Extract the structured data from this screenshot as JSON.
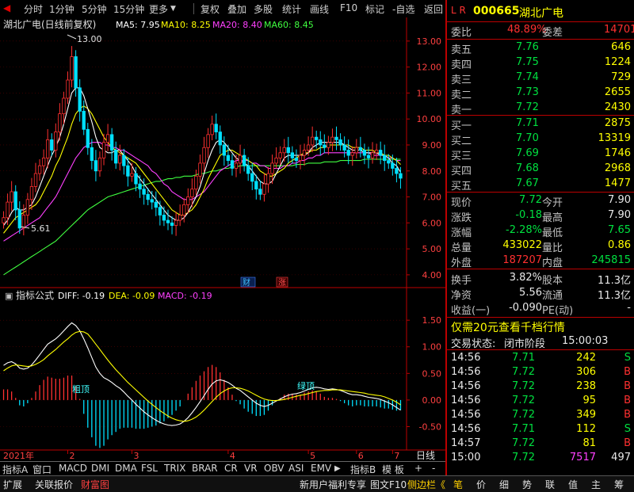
{
  "toolbar": {
    "items": [
      "分时",
      "1分钟",
      "5分钟",
      "15分钟",
      "更多",
      "复权",
      "叠加",
      "多股",
      "统计",
      "画线",
      "F10",
      "标记",
      "-自选",
      "返回"
    ]
  },
  "chart_header": {
    "title": "湖北广电(日线前复权)",
    "ma5": "MA5: 7.95",
    "ma10": "MA10: 8.25",
    "ma20": "MA20: 8.40",
    "ma60": "MA60: 8.45",
    "high_label": "13.00",
    "low_label": "5.61",
    "badge_cai": "财",
    "badge_zhang": "涨"
  },
  "indicator_header": {
    "name": "指标公式",
    "diff": "DIFF: -0.19",
    "dea": "DEA: -0.09",
    "macd": "MACD: -0.19",
    "label_a": "粗顶",
    "label_b": "绿顶"
  },
  "chart_data": [
    {
      "type": "candlestick",
      "ylim": [
        3.6,
        13.3
      ],
      "yticks": [
        "13.00",
        "12.00",
        "11.00",
        "10.00",
        "9.00",
        "8.00",
        "7.00",
        "6.00",
        "5.00",
        "4.00"
      ],
      "series": [
        {
          "name": "MA5",
          "color": "#ffffff"
        },
        {
          "name": "MA10",
          "color": "#ffff00"
        },
        {
          "name": "MA20",
          "color": "#ff40ff"
        },
        {
          "name": "MA60",
          "color": "#40ff40"
        }
      ],
      "close": [
        6.2,
        6.8,
        7.2,
        6.5,
        5.8,
        6.3,
        6.9,
        7.4,
        7.9,
        8.2,
        8.5,
        9.2,
        8.8,
        9.5,
        10.2,
        10.8,
        11.5,
        12.4,
        11.2,
        10.3,
        9.6,
        8.9,
        8.4,
        8.0,
        8.5,
        9.1,
        9.4,
        8.8,
        8.3,
        8.6,
        8.2,
        7.8,
        7.9,
        7.5,
        7.3,
        7.1,
        6.9,
        6.8,
        6.6,
        6.3,
        6.1,
        6.0,
        5.9,
        6.1,
        6.3,
        6.7,
        7.0,
        7.3,
        7.8,
        8.3,
        8.9,
        9.4,
        9.8,
        9.5,
        9.0,
        8.6,
        8.4,
        8.1,
        8.3,
        8.6,
        8.2,
        7.9,
        7.6,
        7.3,
        7.1,
        7.5,
        7.9,
        8.3,
        8.5,
        8.7,
        8.9,
        8.7,
        8.5,
        8.4,
        8.6,
        8.8,
        9.0,
        9.3,
        9.2,
        9.0,
        8.9,
        9.1,
        9.3,
        9.2,
        9.0,
        8.8,
        8.6,
        8.7,
        8.9,
        8.8,
        8.6,
        8.5,
        8.7,
        8.8,
        8.6,
        8.4,
        8.3,
        8.1,
        7.9,
        7.72
      ],
      "ma5": [
        5.9,
        6.1,
        6.4,
        6.6,
        6.5,
        6.5,
        6.6,
        6.7,
        7.0,
        7.4,
        7.8,
        8.2,
        8.6,
        8.9,
        9.3,
        9.8,
        10.4,
        11.0,
        11.2,
        11.2,
        10.9,
        10.4,
        9.9,
        9.3,
        8.9,
        8.8,
        8.7,
        8.7,
        8.8,
        8.8,
        8.6,
        8.4,
        8.2,
        7.9,
        7.7,
        7.5,
        7.3,
        7.1,
        6.9,
        6.7,
        6.5,
        6.3,
        6.2,
        6.1,
        6.1,
        6.2,
        6.4,
        6.7,
        7.0,
        7.4,
        7.9,
        8.4,
        8.8,
        9.1,
        9.2,
        9.1,
        8.9,
        8.7,
        8.5,
        8.4,
        8.3,
        8.2,
        8.0,
        7.8,
        7.6,
        7.5,
        7.5,
        7.6,
        7.9,
        8.2,
        8.5,
        8.6,
        8.6,
        8.6,
        8.6,
        8.6,
        8.7,
        8.9,
        9.0,
        9.1,
        9.1,
        9.1,
        9.1,
        9.1,
        9.1,
        9.0,
        8.9,
        8.8,
        8.8,
        8.8,
        8.7,
        8.7,
        8.7,
        8.7,
        8.6,
        8.6,
        8.5,
        8.3,
        8.2,
        7.95
      ],
      "ma10": [
        5.6,
        5.8,
        6.0,
        6.2,
        6.3,
        6.4,
        6.5,
        6.6,
        6.7,
        6.9,
        7.2,
        7.5,
        7.8,
        8.2,
        8.5,
        8.9,
        9.3,
        9.8,
        10.2,
        10.4,
        10.5,
        10.4,
        10.2,
        9.9,
        9.6,
        9.3,
        9.1,
        8.9,
        8.8,
        8.7,
        8.6,
        8.5,
        8.4,
        8.3,
        8.1,
        7.9,
        7.7,
        7.5,
        7.3,
        7.1,
        6.9,
        6.7,
        6.5,
        6.4,
        6.3,
        6.3,
        6.4,
        6.5,
        6.7,
        7.0,
        7.3,
        7.7,
        8.0,
        8.3,
        8.6,
        8.7,
        8.8,
        8.8,
        8.7,
        8.6,
        8.5,
        8.4,
        8.3,
        8.2,
        8.0,
        7.9,
        7.8,
        7.8,
        7.9,
        8.0,
        8.1,
        8.3,
        8.4,
        8.5,
        8.6,
        8.7,
        8.7,
        8.8,
        8.8,
        8.9,
        8.9,
        9.0,
        9.0,
        9.0,
        9.0,
        9.0,
        9.0,
        8.9,
        8.9,
        8.9,
        8.8,
        8.8,
        8.8,
        8.7,
        8.7,
        8.6,
        8.6,
        8.5,
        8.4,
        8.25
      ],
      "ma20": [
        5.3,
        5.4,
        5.5,
        5.6,
        5.7,
        5.8,
        5.9,
        6.0,
        6.1,
        6.2,
        6.4,
        6.6,
        6.8,
        7.0,
        7.3,
        7.6,
        7.9,
        8.2,
        8.5,
        8.7,
        8.9,
        9.0,
        9.1,
        9.1,
        9.1,
        9.0,
        9.0,
        8.9,
        8.9,
        8.8,
        8.8,
        8.7,
        8.6,
        8.5,
        8.4,
        8.3,
        8.2,
        8.0,
        7.9,
        7.7,
        7.5,
        7.4,
        7.2,
        7.1,
        7.0,
        6.9,
        6.9,
        6.9,
        7.0,
        7.1,
        7.2,
        7.4,
        7.6,
        7.8,
        8.0,
        8.1,
        8.2,
        8.3,
        8.4,
        8.4,
        8.4,
        8.4,
        8.3,
        8.3,
        8.2,
        8.2,
        8.1,
        8.1,
        8.1,
        8.1,
        8.2,
        8.2,
        8.3,
        8.3,
        8.4,
        8.4,
        8.5,
        8.5,
        8.6,
        8.6,
        8.7,
        8.7,
        8.7,
        8.7,
        8.7,
        8.7,
        8.7,
        8.7,
        8.7,
        8.7,
        8.7,
        8.7,
        8.6,
        8.6,
        8.6,
        8.6,
        8.5,
        8.5,
        8.4,
        8.4
      ],
      "ma60": [
        4.0,
        4.1,
        4.2,
        4.3,
        4.4,
        4.5,
        4.6,
        4.7,
        4.8,
        4.9,
        5.0,
        5.1,
        5.2,
        5.3,
        5.45,
        5.6,
        5.75,
        5.9,
        6.05,
        6.2,
        6.35,
        6.5,
        6.6,
        6.7,
        6.8,
        6.9,
        7.0,
        7.05,
        7.1,
        7.15,
        7.2,
        7.25,
        7.3,
        7.35,
        7.4,
        7.45,
        7.5,
        7.55,
        7.6,
        7.6,
        7.65,
        7.7,
        7.7,
        7.75,
        7.75,
        7.8,
        7.8,
        7.8,
        7.85,
        7.9,
        7.9,
        7.95,
        8.0,
        8.0,
        8.05,
        8.1,
        8.1,
        8.15,
        8.15,
        8.2,
        8.2,
        8.2,
        8.2,
        8.2,
        8.2,
        8.2,
        8.2,
        8.2,
        8.2,
        8.2,
        8.2,
        8.2,
        8.2,
        8.25,
        8.25,
        8.25,
        8.3,
        8.3,
        8.3,
        8.3,
        8.35,
        8.35,
        8.35,
        8.35,
        8.4,
        8.4,
        8.4,
        8.4,
        8.4,
        8.4,
        8.45,
        8.45,
        8.45,
        8.45,
        8.45,
        8.45,
        8.45,
        8.45,
        8.45,
        8.45
      ]
    },
    {
      "type": "bar",
      "ylim": [
        -0.85,
        1.8
      ],
      "yticks": [
        "1.50",
        "1.00",
        "0.50",
        "0.00",
        "-0.50"
      ],
      "series": [
        {
          "name": "DIFF",
          "color": "#ffffff"
        },
        {
          "name": "DEA",
          "color": "#ffff00"
        },
        {
          "name": "MACD",
          "color": "#ff40ff"
        }
      ],
      "diff": [
        0.65,
        0.7,
        0.72,
        0.68,
        0.6,
        0.58,
        0.6,
        0.66,
        0.75,
        0.85,
        0.95,
        1.05,
        1.1,
        1.15,
        1.22,
        1.3,
        1.38,
        1.45,
        1.4,
        1.3,
        1.15,
        0.98,
        0.8,
        0.62,
        0.5,
        0.42,
        0.38,
        0.33,
        0.27,
        0.22,
        0.15,
        0.07,
        0.0,
        -0.08,
        -0.15,
        -0.22,
        -0.28,
        -0.33,
        -0.38,
        -0.42,
        -0.45,
        -0.47,
        -0.48,
        -0.47,
        -0.45,
        -0.4,
        -0.33,
        -0.24,
        -0.14,
        -0.03,
        0.08,
        0.2,
        0.3,
        0.36,
        0.38,
        0.36,
        0.33,
        0.28,
        0.22,
        0.18,
        0.12,
        0.06,
        0.0,
        -0.06,
        -0.1,
        -0.12,
        -0.1,
        -0.06,
        -0.02,
        0.02,
        0.06,
        0.09,
        0.11,
        0.12,
        0.14,
        0.17,
        0.2,
        0.23,
        0.24,
        0.23,
        0.21,
        0.2,
        0.21,
        0.2,
        0.18,
        0.15,
        0.12,
        0.1,
        0.1,
        0.09,
        0.07,
        0.05,
        0.04,
        0.03,
        0.01,
        -0.02,
        -0.05,
        -0.09,
        -0.14,
        -0.19
      ],
      "dea": [
        0.55,
        0.6,
        0.64,
        0.66,
        0.65,
        0.64,
        0.63,
        0.64,
        0.67,
        0.71,
        0.76,
        0.83,
        0.89,
        0.95,
        1.02,
        1.09,
        1.15,
        1.22,
        1.27,
        1.29,
        1.28,
        1.24,
        1.15,
        1.05,
        0.95,
        0.85,
        0.75,
        0.66,
        0.57,
        0.49,
        0.41,
        0.33,
        0.26,
        0.19,
        0.12,
        0.05,
        -0.02,
        -0.08,
        -0.14,
        -0.2,
        -0.25,
        -0.3,
        -0.34,
        -0.37,
        -0.39,
        -0.4,
        -0.39,
        -0.36,
        -0.32,
        -0.26,
        -0.19,
        -0.11,
        -0.03,
        0.05,
        0.12,
        0.17,
        0.21,
        0.23,
        0.23,
        0.22,
        0.2,
        0.17,
        0.13,
        0.09,
        0.05,
        0.02,
        0.0,
        -0.01,
        -0.01,
        0.0,
        0.01,
        0.03,
        0.05,
        0.07,
        0.09,
        0.1,
        0.12,
        0.14,
        0.16,
        0.17,
        0.18,
        0.18,
        0.19,
        0.19,
        0.19,
        0.18,
        0.17,
        0.16,
        0.15,
        0.14,
        0.13,
        0.11,
        0.1,
        0.09,
        0.08,
        0.06,
        0.03,
        0.0,
        -0.04,
        -0.09
      ],
      "macd": [
        0.2,
        0.2,
        0.16,
        0.04,
        -0.1,
        -0.12,
        -0.06,
        0.04,
        0.16,
        0.28,
        0.38,
        0.44,
        0.42,
        0.4,
        0.4,
        0.42,
        0.46,
        0.46,
        0.26,
        0.02,
        -0.26,
        -0.52,
        -0.7,
        -0.86,
        -0.9,
        -0.86,
        -0.74,
        -0.66,
        -0.6,
        -0.54,
        -0.52,
        -0.52,
        -0.52,
        -0.54,
        -0.54,
        -0.54,
        -0.52,
        -0.5,
        -0.48,
        -0.44,
        -0.4,
        -0.34,
        -0.28,
        -0.2,
        -0.12,
        0.0,
        0.12,
        0.24,
        0.36,
        0.46,
        0.54,
        0.62,
        0.66,
        0.62,
        0.52,
        0.38,
        0.24,
        0.1,
        -0.02,
        -0.08,
        -0.16,
        -0.22,
        -0.26,
        -0.3,
        -0.3,
        -0.28,
        -0.2,
        -0.1,
        -0.02,
        0.04,
        0.1,
        0.12,
        0.12,
        0.1,
        0.1,
        0.14,
        0.16,
        0.18,
        0.16,
        0.12,
        0.06,
        0.04,
        0.04,
        0.02,
        -0.02,
        -0.06,
        -0.1,
        -0.12,
        -0.1,
        -0.1,
        -0.12,
        -0.12,
        -0.12,
        -0.12,
        -0.14,
        -0.16,
        -0.16,
        -0.18,
        -0.2,
        -0.19
      ]
    }
  ],
  "x_axis": {
    "labels": [
      "2021年",
      "2",
      "3",
      "4",
      "5",
      "6",
      "7"
    ],
    "period": "日线"
  },
  "quote": {
    "flags": "L  R",
    "code": "000665",
    "name": "湖北广电",
    "weibi_label": "委比",
    "weibi": "48.89%",
    "weicha_label": "委差",
    "weicha": "14701",
    "asks": [
      {
        "label": "卖五",
        "price": "7.76",
        "vol": "646"
      },
      {
        "label": "卖四",
        "price": "7.75",
        "vol": "1224"
      },
      {
        "label": "卖三",
        "price": "7.74",
        "vol": "729"
      },
      {
        "label": "卖二",
        "price": "7.73",
        "vol": "2655"
      },
      {
        "label": "卖一",
        "price": "7.72",
        "vol": "2430"
      }
    ],
    "bids": [
      {
        "label": "买一",
        "price": "7.71",
        "vol": "2875"
      },
      {
        "label": "买二",
        "price": "7.70",
        "vol": "13319"
      },
      {
        "label": "买三",
        "price": "7.69",
        "vol": "1746"
      },
      {
        "label": "买四",
        "price": "7.68",
        "vol": "2968"
      },
      {
        "label": "买五",
        "price": "7.67",
        "vol": "1477"
      }
    ],
    "stats": [
      {
        "l1": "现价",
        "v1": "7.72",
        "l2": "今开",
        "v2": "7.90"
      },
      {
        "l1": "涨跌",
        "v1": "-0.18",
        "l2": "最高",
        "v2": "7.90"
      },
      {
        "l1": "涨幅",
        "v1": "-2.28%",
        "l2": "最低",
        "v2": "7.65"
      },
      {
        "l1": "总量",
        "v1": "433022",
        "l2": "量比",
        "v2": "0.86"
      },
      {
        "l1": "外盘",
        "v1": "187207",
        "l2": "内盘",
        "v2": "245815"
      }
    ],
    "info": [
      {
        "l1": "换手",
        "v1": "3.82%",
        "l2": "股本",
        "v2": "11.3亿"
      },
      {
        "l1": "净资",
        "v1": "5.56",
        "l2": "流通",
        "v2": "11.3亿"
      },
      {
        "l1": "收益(一)",
        "v1": "-0.090",
        "l2": "PE(动)",
        "v2": "-"
      }
    ],
    "promo": "仅需20元查看千档行情",
    "trade_status_label": "交易状态:",
    "trade_status": "闭市阶段",
    "trade_time": "15:00:03",
    "ticks": [
      {
        "time": "14:56",
        "price": "7.71",
        "vol": "242",
        "bs": "S"
      },
      {
        "time": "14:56",
        "price": "7.72",
        "vol": "306",
        "bs": "B"
      },
      {
        "time": "14:56",
        "price": "7.72",
        "vol": "238",
        "bs": "B"
      },
      {
        "time": "14:56",
        "price": "7.72",
        "vol": "95",
        "bs": "B"
      },
      {
        "time": "14:56",
        "price": "7.72",
        "vol": "349",
        "bs": "B"
      },
      {
        "time": "14:56",
        "price": "7.71",
        "vol": "112",
        "bs": "S"
      },
      {
        "time": "14:57",
        "price": "7.72",
        "vol": "81",
        "bs": "B"
      },
      {
        "time": "15:00",
        "price": "7.72",
        "vol": "7517",
        "bs": "497"
      }
    ]
  },
  "indicator_tabs": [
    "指标A",
    "窗口",
    "MACD",
    "DMI",
    "DMA",
    "FSL",
    "TRIX",
    "BRAR",
    "CR",
    "VR",
    "OBV",
    "ASI",
    "EMV",
    "指标B",
    "模 板",
    "+",
    "-"
  ],
  "status_bar": {
    "left": [
      "扩展",
      "关联报价",
      "财富图"
    ],
    "mid": [
      "新用户福利专享",
      "图文F10",
      "侧边栏《"
    ],
    "right": [
      "笔",
      "价",
      "细",
      "势",
      "联",
      "值",
      "主",
      "筹"
    ]
  },
  "colors": {
    "up": "#ff3030",
    "down": "#00e0ff",
    "bg": "#000000",
    "border": "#b00000"
  }
}
